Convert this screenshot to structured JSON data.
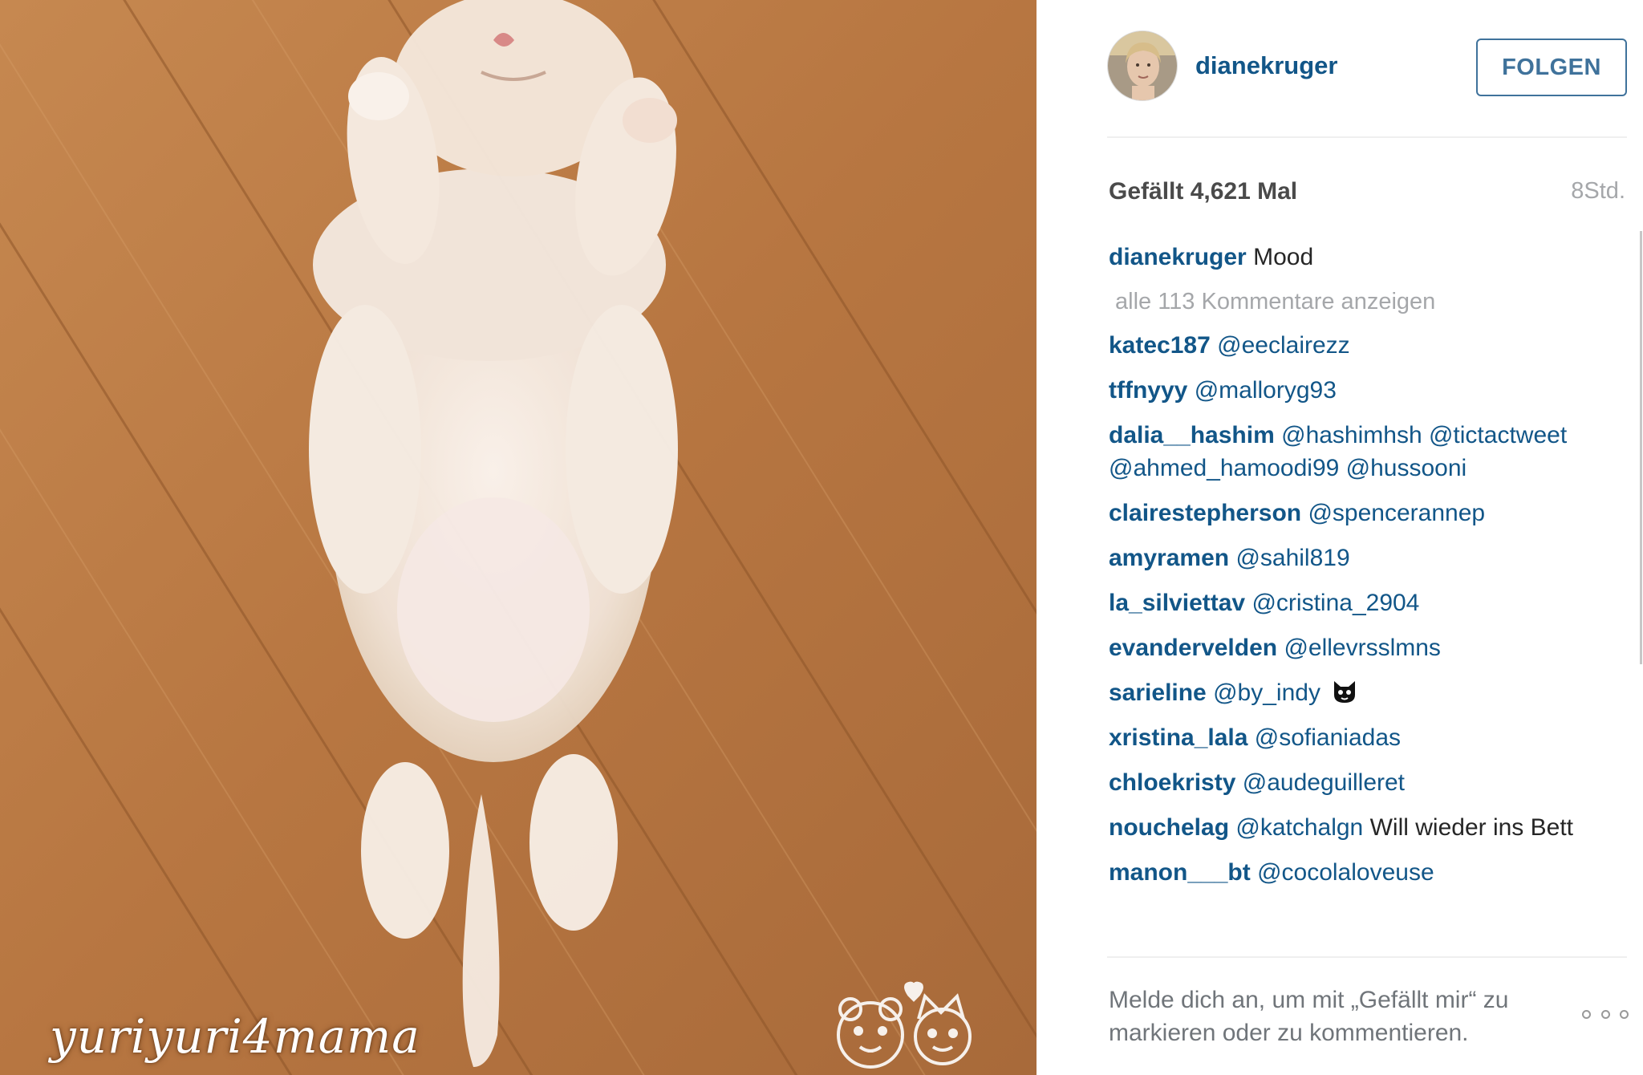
{
  "photo": {
    "watermark": "yuriyuri4mama",
    "alt": "Sleeping white kitten lying on its back on a wooden floor"
  },
  "header": {
    "username": "dianekruger",
    "follow_label": "FOLGEN"
  },
  "stats": {
    "likes": "Gefällt 4,621 Mal",
    "time": "8Std."
  },
  "caption": {
    "user": "dianekruger",
    "text": "Mood"
  },
  "all_comments_link": "alle 113 Kommentare anzeigen",
  "comments": [
    {
      "user": "katec187",
      "mention": "@eeclairezz",
      "text": ""
    },
    {
      "user": "tffnyyy",
      "mention": "@malloryg93",
      "text": ""
    },
    {
      "user": "dalia__hashim",
      "mention": "@hashimhsh @tictactweet @ahmed_hamoodi99 @hussooni",
      "text": ""
    },
    {
      "user": "clairestepherson",
      "mention": "@spencerannep",
      "text": ""
    },
    {
      "user": "amyramen",
      "mention": "@sahil819",
      "text": ""
    },
    {
      "user": "la_silviettav",
      "mention": "@cristina_2904",
      "text": ""
    },
    {
      "user": "evandervelden",
      "mention": "@ellevrsslmns",
      "text": ""
    },
    {
      "user": "sarieline",
      "mention": "@by_indy",
      "text": ""
    },
    {
      "user": "xristina_lala",
      "mention": "@sofianiadas",
      "text": ""
    },
    {
      "user": "chloekristy",
      "mention": "@audeguilleret",
      "text": ""
    },
    {
      "user": "nouchelag",
      "mention": "@katchalgn",
      "text": "Will wieder ins Bett"
    },
    {
      "user": "manon___bt",
      "mention": "@cocolaloveuse",
      "text": ""
    }
  ],
  "footer": {
    "login_note": "Melde dich an, um mit „Gefällt mir“ zu markieren oder zu kommentieren."
  },
  "icons": {
    "more": "more-options-icon",
    "emoji": "cat-face-icon"
  },
  "colors": {
    "link_blue": "#125688",
    "button_blue": "#3f729b",
    "muted_gray": "#a5a7aa"
  }
}
